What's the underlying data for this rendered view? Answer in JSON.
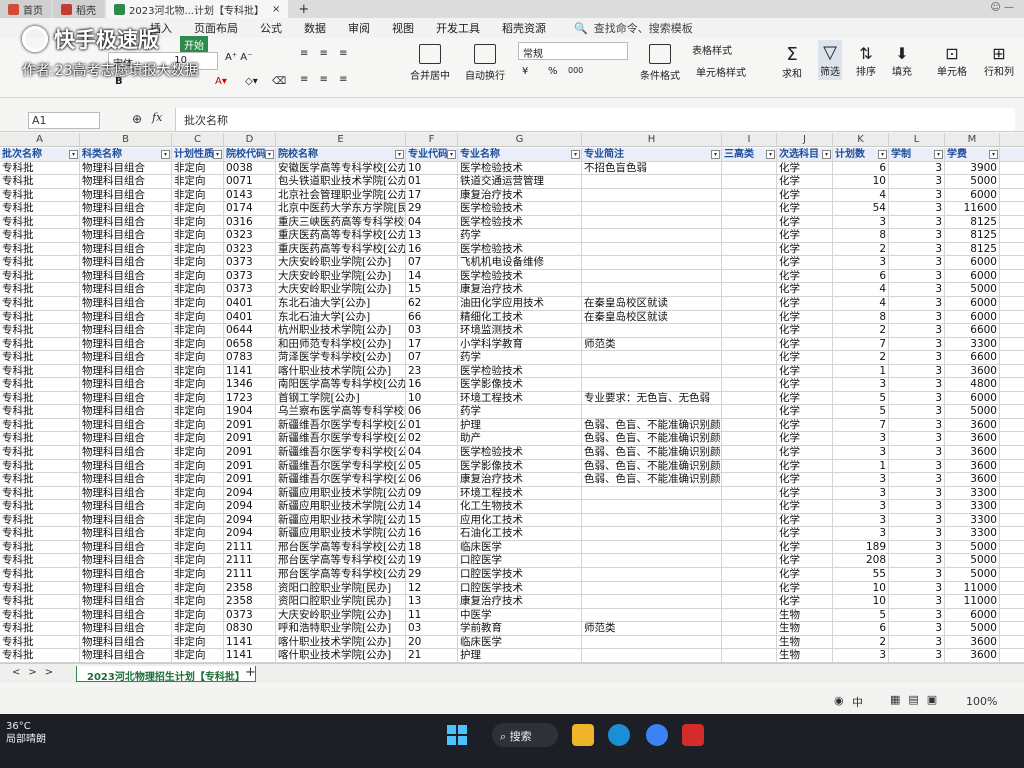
{
  "browser_tabs": [
    {
      "label": "首页",
      "color": "#d24b35"
    },
    {
      "label": "稻壳",
      "color": "#c43a30"
    },
    {
      "label": "2023河北物...计划【专科批】",
      "color": "#2e8b4a"
    }
  ],
  "menu": [
    "插入",
    "页面布局",
    "公式",
    "数据",
    "审阅",
    "视图",
    "开发工具",
    "稻壳资源"
  ],
  "menu_search": "查找命令、搜索模板",
  "ribbon": {
    "start": "开始",
    "font_name": "宋体",
    "font_size": "10",
    "merge": "合并居中",
    "wrap": "自动换行",
    "number_format": "常规",
    "currency": "¥",
    "percent": "%",
    "thousands": "000",
    "cond_format": "条件格式",
    "table_style": "表格样式",
    "cell_style": "单元格样式",
    "sum": "求和",
    "filter": "筛选",
    "sort": "排序",
    "fill": "填充",
    "cells": "单元格",
    "rows_cols": "行和列"
  },
  "formula_bar": {
    "cell_ref": "A1",
    "fx": "fx",
    "value": "批次名称"
  },
  "columns": [
    "A",
    "B",
    "C",
    "D",
    "E",
    "F",
    "G",
    "H",
    "I",
    "J",
    "K",
    "L",
    "M"
  ],
  "headers": [
    "批次名称",
    "科类名称",
    "计划性质",
    "院校代码",
    "院校名称",
    "专业代码",
    "专业名称",
    "专业简注",
    "三高类",
    "次选科目",
    "计划数",
    "学制",
    "学费"
  ],
  "rows": [
    [
      "专科批",
      "物理科目组合",
      "非定向",
      "0038",
      "安徽医学高等专科学校[公办]",
      "10",
      "医学检验技术",
      "不招色盲色弱",
      "",
      "化学",
      "6",
      "3",
      "3900"
    ],
    [
      "专科批",
      "物理科目组合",
      "非定向",
      "0071",
      "包头铁道职业技术学院[公办]",
      "01",
      "铁道交通运营管理",
      "",
      "",
      "化学",
      "10",
      "3",
      "5000"
    ],
    [
      "专科批",
      "物理科目组合",
      "非定向",
      "0143",
      "北京社会管理职业学院[公办]",
      "17",
      "康复治疗技术",
      "",
      "",
      "化学",
      "4",
      "3",
      "6000"
    ],
    [
      "专科批",
      "物理科目组合",
      "非定向",
      "0174",
      "北京中医药大学东方学院[民办]",
      "29",
      "医学检验技术",
      "",
      "",
      "化学",
      "54",
      "3",
      "11600"
    ],
    [
      "专科批",
      "物理科目组合",
      "非定向",
      "0316",
      "重庆三峡医药高等专科学校[公办]",
      "04",
      "医学检验技术",
      "",
      "",
      "化学",
      "3",
      "3",
      "8125"
    ],
    [
      "专科批",
      "物理科目组合",
      "非定向",
      "0323",
      "重庆医药高等专科学校[公办]",
      "13",
      "药学",
      "",
      "",
      "化学",
      "8",
      "3",
      "8125"
    ],
    [
      "专科批",
      "物理科目组合",
      "非定向",
      "0323",
      "重庆医药高等专科学校[公办]",
      "16",
      "医学检验技术",
      "",
      "",
      "化学",
      "2",
      "3",
      "8125"
    ],
    [
      "专科批",
      "物理科目组合",
      "非定向",
      "0373",
      "大庆安岭职业学院[公办]",
      "07",
      "飞机机电设备维修",
      "",
      "",
      "化学",
      "3",
      "3",
      "6000"
    ],
    [
      "专科批",
      "物理科目组合",
      "非定向",
      "0373",
      "大庆安岭职业学院[公办]",
      "14",
      "医学检验技术",
      "",
      "",
      "化学",
      "6",
      "3",
      "6000"
    ],
    [
      "专科批",
      "物理科目组合",
      "非定向",
      "0373",
      "大庆安岭职业学院[公办]",
      "15",
      "康复治疗技术",
      "",
      "",
      "化学",
      "4",
      "3",
      "5000"
    ],
    [
      "专科批",
      "物理科目组合",
      "非定向",
      "0401",
      "东北石油大学[公办]",
      "62",
      "油田化学应用技术",
      "在秦皇岛校区就读",
      "",
      "化学",
      "4",
      "3",
      "6000"
    ],
    [
      "专科批",
      "物理科目组合",
      "非定向",
      "0401",
      "东北石油大学[公办]",
      "66",
      "精细化工技术",
      "在秦皇岛校区就读",
      "",
      "化学",
      "8",
      "3",
      "6000"
    ],
    [
      "专科批",
      "物理科目组合",
      "非定向",
      "0644",
      "杭州职业技术学院[公办]",
      "03",
      "环境监测技术",
      "",
      "",
      "化学",
      "2",
      "3",
      "6600"
    ],
    [
      "专科批",
      "物理科目组合",
      "非定向",
      "0658",
      "和田师范专科学校[公办]",
      "17",
      "小学科学教育",
      "师范类",
      "",
      "化学",
      "7",
      "3",
      "3300"
    ],
    [
      "专科批",
      "物理科目组合",
      "非定向",
      "0783",
      "菏泽医学专科学校[公办]",
      "07",
      "药学",
      "",
      "",
      "化学",
      "2",
      "3",
      "6600"
    ],
    [
      "专科批",
      "物理科目组合",
      "非定向",
      "1141",
      "喀什职业技术学院[公办]",
      "23",
      "医学检验技术",
      "",
      "",
      "化学",
      "1",
      "3",
      "3600"
    ],
    [
      "专科批",
      "物理科目组合",
      "非定向",
      "1346",
      "南阳医学高等专科学校[公办]",
      "16",
      "医学影像技术",
      "",
      "",
      "化学",
      "3",
      "3",
      "4800"
    ],
    [
      "专科批",
      "物理科目组合",
      "非定向",
      "1723",
      "首钢工学院[公办]",
      "10",
      "环境工程技术",
      "专业要求：无色盲、无色弱",
      "",
      "化学",
      "5",
      "3",
      "6000"
    ],
    [
      "专科批",
      "物理科目组合",
      "非定向",
      "1904",
      "乌兰察布医学高等专科学校[公办]",
      "06",
      "药学",
      "",
      "",
      "化学",
      "5",
      "3",
      "5000"
    ],
    [
      "专科批",
      "物理科目组合",
      "非定向",
      "2091",
      "新疆维吾尔医学专科学校[公办]",
      "01",
      "护理",
      "色弱、色盲、不能准确识别颜色",
      "",
      "化学",
      "7",
      "3",
      "3600"
    ],
    [
      "专科批",
      "物理科目组合",
      "非定向",
      "2091",
      "新疆维吾尔医学专科学校[公办]",
      "02",
      "助产",
      "色弱、色盲、不能准确识别颜色",
      "",
      "化学",
      "3",
      "3",
      "3600"
    ],
    [
      "专科批",
      "物理科目组合",
      "非定向",
      "2091",
      "新疆维吾尔医学专科学校[公办]",
      "04",
      "医学检验技术",
      "色弱、色盲、不能准确识别颜色",
      "",
      "化学",
      "3",
      "3",
      "3600"
    ],
    [
      "专科批",
      "物理科目组合",
      "非定向",
      "2091",
      "新疆维吾尔医学专科学校[公办]",
      "05",
      "医学影像技术",
      "色弱、色盲、不能准确识别颜色",
      "",
      "化学",
      "1",
      "3",
      "3600"
    ],
    [
      "专科批",
      "物理科目组合",
      "非定向",
      "2091",
      "新疆维吾尔医学专科学校[公办]",
      "06",
      "康复治疗技术",
      "色弱、色盲、不能准确识别颜色",
      "",
      "化学",
      "3",
      "3",
      "3600"
    ],
    [
      "专科批",
      "物理科目组合",
      "非定向",
      "2094",
      "新疆应用职业技术学院[公办]",
      "09",
      "环境工程技术",
      "",
      "",
      "化学",
      "3",
      "3",
      "3300"
    ],
    [
      "专科批",
      "物理科目组合",
      "非定向",
      "2094",
      "新疆应用职业技术学院[公办]",
      "14",
      "化工生物技术",
      "",
      "",
      "化学",
      "3",
      "3",
      "3300"
    ],
    [
      "专科批",
      "物理科目组合",
      "非定向",
      "2094",
      "新疆应用职业技术学院[公办]",
      "15",
      "应用化工技术",
      "",
      "",
      "化学",
      "3",
      "3",
      "3300"
    ],
    [
      "专科批",
      "物理科目组合",
      "非定向",
      "2094",
      "新疆应用职业技术学院[公办]",
      "16",
      "石油化工技术",
      "",
      "",
      "化学",
      "3",
      "3",
      "3300"
    ],
    [
      "专科批",
      "物理科目组合",
      "非定向",
      "2111",
      "邢台医学高等专科学校[公办]",
      "18",
      "临床医学",
      "",
      "",
      "化学",
      "189",
      "3",
      "5000"
    ],
    [
      "专科批",
      "物理科目组合",
      "非定向",
      "2111",
      "邢台医学高等专科学校[公办]",
      "19",
      "口腔医学",
      "",
      "",
      "化学",
      "208",
      "3",
      "5000"
    ],
    [
      "专科批",
      "物理科目组合",
      "非定向",
      "2111",
      "邢台医学高等专科学校[公办]",
      "29",
      "口腔医学技术",
      "",
      "",
      "化学",
      "55",
      "3",
      "5000"
    ],
    [
      "专科批",
      "物理科目组合",
      "非定向",
      "2358",
      "资阳口腔职业学院[民办]",
      "12",
      "口腔医学技术",
      "",
      "",
      "化学",
      "10",
      "3",
      "11000"
    ],
    [
      "专科批",
      "物理科目组合",
      "非定向",
      "2358",
      "资阳口腔职业学院[民办]",
      "13",
      "康复治疗技术",
      "",
      "",
      "化学",
      "10",
      "3",
      "11000"
    ],
    [
      "专科批",
      "物理科目组合",
      "非定向",
      "0373",
      "大庆安岭职业学院[公办]",
      "11",
      "中医学",
      "",
      "",
      "生物",
      "5",
      "3",
      "6000"
    ],
    [
      "专科批",
      "物理科目组合",
      "非定向",
      "0830",
      "呼和浩特职业学院[公办]",
      "03",
      "学前教育",
      "师范类",
      "",
      "生物",
      "6",
      "3",
      "5000"
    ],
    [
      "专科批",
      "物理科目组合",
      "非定向",
      "1141",
      "喀什职业技术学院[公办]",
      "20",
      "临床医学",
      "",
      "",
      "生物",
      "2",
      "3",
      "3600"
    ],
    [
      "专科批",
      "物理科目组合",
      "非定向",
      "1141",
      "喀什职业技术学院[公办]",
      "21",
      "护理",
      "",
      "",
      "生物",
      "3",
      "3",
      "3600"
    ]
  ],
  "sheet_tab": "2023河北物理招生计划【专科批】",
  "status": {
    "zoom": "100%",
    "input_mode": "中"
  },
  "taskbar": {
    "temp": "36°C",
    "weather": "局部晴朗",
    "search": "搜索"
  },
  "watermark": {
    "app": "快手极速版",
    "author": "作者:23高考志愿填报大数据"
  },
  "colors": {
    "header_text": "#1f4e9a",
    "sheet_green": "#2e8b4a",
    "taskbar": "#1c1f26"
  }
}
